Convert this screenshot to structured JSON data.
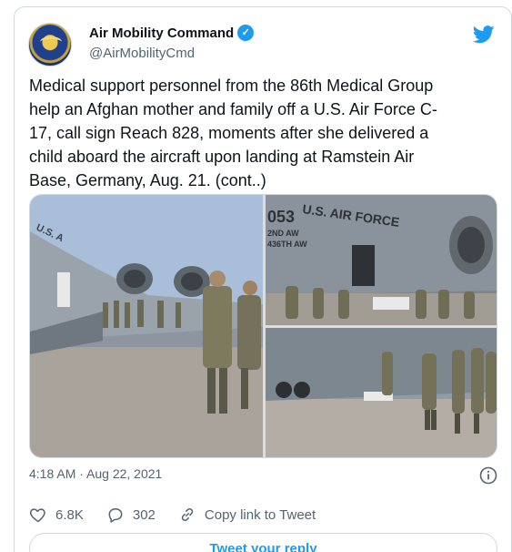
{
  "author": {
    "display_name": "Air Mobility Command",
    "handle": "@AirMobilityCmd",
    "avatar_icon": "air-mobility-command-seal",
    "verified": true
  },
  "tweet": {
    "text": "Medical support personnel from the 86th Medical Group\nhelp an Afghan mother and family off a U.S. Air Force C-\n17, call sign Reach 828, moments after she delivered a\nchild aboard the aircraft upon landing at Ramstein Air\nBase, Germany, Aug. 21. (cont..)",
    "timestamp": "4:18 AM · Aug 22, 2021"
  },
  "media": {
    "photo_top_fuselage_text": "U.S. AIR FORCE",
    "photo_top_tail_number": "053",
    "photo_top_wing_text_1": "2ND AW",
    "photo_top_wing_text_2": "436TH AW",
    "photo_main_fuselage_text": "U.S. A"
  },
  "actions": {
    "likes_count": "6.8K",
    "replies_count": "302",
    "copy_link_label": "Copy link to Tweet",
    "reply_button_label": "Tweet your reply"
  },
  "colors": {
    "brand_blue": "#1d9bf0",
    "text_secondary": "#536471",
    "border": "#cfd9de"
  }
}
